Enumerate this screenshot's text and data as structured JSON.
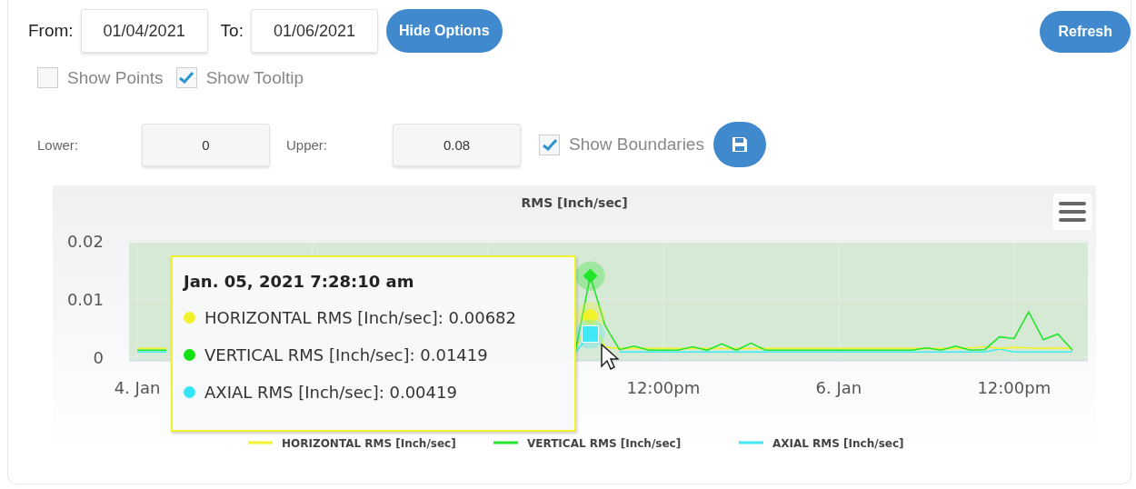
{
  "date_range": {
    "from_label": "From:",
    "from_value": "01/04/2021",
    "to_label": "To:",
    "to_value": "01/06/2021",
    "hide_options_button": "Hide Options",
    "refresh_button": "Refresh"
  },
  "display_options": [
    {
      "label": "Show Points",
      "checked": false
    },
    {
      "label": "Show Tooltip",
      "checked": true
    }
  ],
  "boundaries": {
    "lower_label": "Lower:",
    "lower_value": "0",
    "upper_label": "Upper:",
    "upper_value": "0.08",
    "show_boundaries": {
      "label": "Show Boundaries",
      "checked": true
    }
  },
  "chart": {
    "chart_data": {
      "type": "line",
      "title": "RMS [Inch/sec]",
      "grid": true,
      "legend": true,
      "categories": [
        "4. Jan",
        null,
        null,
        null,
        null,
        null,
        null,
        null,
        null,
        null,
        null,
        null,
        null,
        null,
        null,
        null,
        null,
        null,
        null,
        null,
        null,
        null,
        null,
        null,
        null,
        null,
        null,
        null,
        null,
        null,
        null,
        null,
        null,
        null,
        null,
        null,
        "12:00pm",
        null,
        null,
        null,
        null,
        null,
        null,
        null,
        null,
        null,
        null,
        null,
        "6. Jan",
        null,
        null,
        null,
        null,
        null,
        null,
        null,
        null,
        null,
        null,
        null,
        "12:00pm",
        null,
        null,
        null,
        null
      ],
      "series": [
        {
          "name": "HORIZONTAL RMS [Inch/sec]",
          "color": "#f2f22a",
          "values": [
            0.0015,
            0.0015,
            0.0015,
            null,
            null,
            null,
            null,
            null,
            null,
            null,
            null,
            null,
            null,
            null,
            null,
            null,
            null,
            null,
            null,
            null,
            null,
            null,
            null,
            null,
            null,
            null,
            null,
            null,
            null,
            null,
            0.0015,
            0.007,
            0.0017,
            0.0015,
            0.0015,
            0.0015,
            0.0015,
            0.0015,
            0.0015,
            0.0015,
            0.0015,
            0.0015,
            0.0015,
            0.0015,
            0.0015,
            0.0015,
            0.0015,
            0.0015,
            0.0015,
            0.0015,
            0.0015,
            0.0015,
            0.0015,
            0.0015,
            0.0015,
            0.0015,
            0.0015,
            0.0016,
            0.0018,
            0.0015,
            0.0017,
            0.0016,
            0.0015,
            0.0016,
            0.0015
          ]
        },
        {
          "name": "VERTICAL RMS [Inch/sec]",
          "color": "#22e62a",
          "values": [
            0.0012,
            0.0012,
            0.0012,
            null,
            null,
            null,
            null,
            null,
            null,
            null,
            null,
            null,
            null,
            null,
            null,
            null,
            null,
            null,
            null,
            null,
            null,
            null,
            null,
            null,
            null,
            null,
            null,
            null,
            null,
            null,
            0.0012,
            0.014,
            0.0055,
            0.0013,
            0.0019,
            0.0012,
            0.0012,
            0.0012,
            0.0018,
            0.0012,
            0.0023,
            0.0012,
            0.0024,
            0.0012,
            0.0012,
            0.0012,
            0.0012,
            0.0012,
            0.0012,
            0.0012,
            0.0012,
            0.0012,
            0.0012,
            0.0012,
            0.0016,
            0.0012,
            0.0019,
            0.0012,
            0.0013,
            0.0035,
            0.0032,
            0.0078,
            0.003,
            0.004,
            0.0012
          ]
        },
        {
          "name": "AXIAL RMS [Inch/sec]",
          "color": "#3ee8f5",
          "values": [
            0.0009,
            0.0009,
            0.0009,
            null,
            null,
            null,
            null,
            null,
            null,
            null,
            null,
            null,
            null,
            null,
            null,
            null,
            null,
            null,
            null,
            null,
            null,
            null,
            null,
            null,
            null,
            null,
            null,
            null,
            null,
            null,
            0.0009,
            0.004,
            null,
            0.0009,
            0.0009,
            0.0009,
            0.0009,
            0.0009,
            0.0009,
            0.0009,
            0.0009,
            0.0009,
            0.0009,
            0.0009,
            0.0009,
            0.0009,
            0.0009,
            0.0009,
            0.0009,
            0.0009,
            0.0009,
            0.0009,
            0.0009,
            0.0009,
            0.0009,
            0.0009,
            0.0009,
            0.0009,
            0.0009,
            0.0014,
            0.0009,
            0.0009,
            0.0009,
            0.0009,
            0.0009
          ]
        }
      ],
      "ylim": [
        0,
        0.02
      ],
      "yticks": [
        0,
        0.01,
        0.02
      ]
    },
    "tooltip": {
      "title": "Jan. 05, 2021 7:28:10 am",
      "entries": [
        {
          "text": "HORIZONTAL RMS [Inch/sec]: 0.00682",
          "color": "#f2f22a"
        },
        {
          "text": "VERTICAL RMS [Inch/sec]: 0.01419",
          "color": "#11e011"
        },
        {
          "text": "AXIAL RMS [Inch/sec]: 0.00419",
          "color": "#33e5f7"
        }
      ]
    }
  }
}
